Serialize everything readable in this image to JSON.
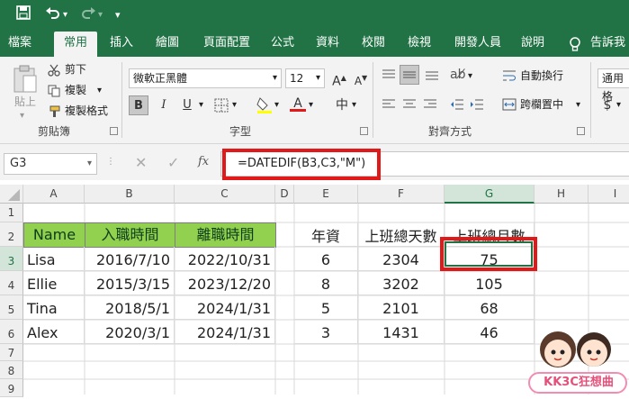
{
  "quick_access": {
    "save_icon": "save-icon",
    "undo_icon": "undo-icon",
    "redo_icon": "redo-icon",
    "customize_icon": "chevron-down-icon"
  },
  "tabs": [
    "檔案",
    "常用",
    "插入",
    "繪圖",
    "頁面配置",
    "公式",
    "資料",
    "校閱",
    "檢視",
    "開發人員",
    "說明",
    "告訴我"
  ],
  "active_tab": "常用",
  "ribbon": {
    "clipboard": {
      "paste": "貼上",
      "cut": "剪下",
      "copy": "複製",
      "format_painter": "複製格式",
      "label": "剪貼簿"
    },
    "font": {
      "name": "微軟正黑體",
      "size": "12",
      "bold": "B",
      "italic": "I",
      "underline": "U",
      "label": "字型",
      "phonetic": "中"
    },
    "alignment": {
      "wrap": "自動換行",
      "merge": "跨欄置中",
      "label": "對齊方式"
    },
    "number": {
      "format": "通用格",
      "currency": "$"
    }
  },
  "formula_bar": {
    "name_box": "G3",
    "fx": "fx",
    "formula": "=DATEDIF(B3,C3,\"M\")"
  },
  "columns": [
    "A",
    "B",
    "C",
    "D",
    "E",
    "F",
    "G",
    "H",
    "I"
  ],
  "rows": [
    "1",
    "2",
    "3",
    "4",
    "5",
    "6",
    "7",
    "8",
    "9"
  ],
  "headers": {
    "name": "Name",
    "start": "入職時間",
    "leave": "離職時間",
    "years": "年資",
    "days": "上班總天數",
    "months": "上班總月數"
  },
  "table": [
    {
      "name": "Lisa",
      "start": "2016/7/10",
      "leave": "2022/10/31",
      "years": "6",
      "days": "2304",
      "months": "75"
    },
    {
      "name": "Ellie",
      "start": "2015/3/15",
      "leave": "2023/12/20",
      "years": "8",
      "days": "3202",
      "months": "105"
    },
    {
      "name": "Tina",
      "start": "2018/5/1",
      "leave": "2024/1/31",
      "years": "5",
      "days": "2101",
      "months": "68"
    },
    {
      "name": "Alex",
      "start": "2020/3/1",
      "leave": "2024/1/31",
      "years": "3",
      "days": "1431",
      "months": "46"
    }
  ],
  "watermark": "KK3C狂想曲",
  "colors": {
    "excel_green": "#217346",
    "header_fill": "#92d050",
    "highlight_red": "#e11919"
  }
}
